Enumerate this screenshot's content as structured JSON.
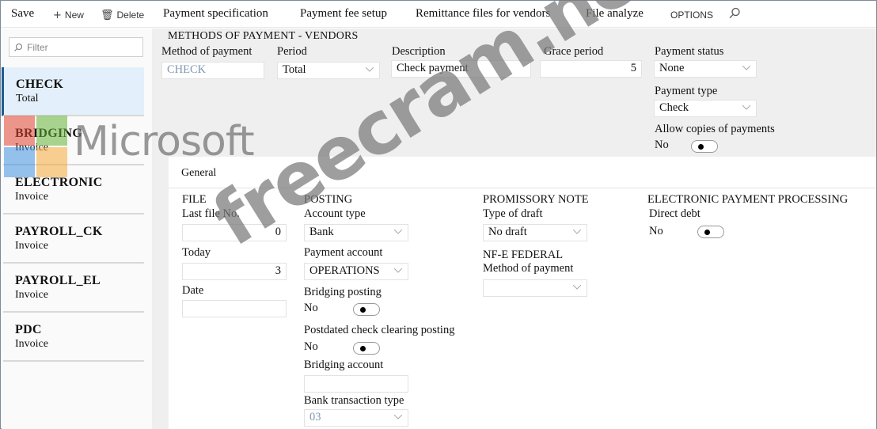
{
  "toolbar": {
    "save": "Save",
    "new": "New",
    "delete": "Delete",
    "payment_specification": "Payment specification",
    "payment_fee_setup": "Payment fee setup",
    "remittance_files": "Remittance files for vendors",
    "file_analyze": "File analyze",
    "options": "OPTIONS",
    "icons": {
      "new": "plus-icon",
      "delete": "trash-icon",
      "search": "search-icon"
    }
  },
  "sidebar": {
    "filter_placeholder": "Filter",
    "items": [
      {
        "title": "CHECK",
        "subtitle": "Total",
        "selected": true
      },
      {
        "title": "BRIDGING",
        "subtitle": "Invoice",
        "selected": false
      },
      {
        "title": "ELECTRONIC",
        "subtitle": "Invoice",
        "selected": false
      },
      {
        "title": "PAYROLL_CK",
        "subtitle": "Invoice",
        "selected": false
      },
      {
        "title": "PAYROLL_EL",
        "subtitle": "Invoice",
        "selected": false
      },
      {
        "title": "PDC",
        "subtitle": "Invoice",
        "selected": false
      }
    ]
  },
  "header": {
    "section_title": "METHODS OF PAYMENT - VENDORS",
    "method_of_payment": {
      "label": "Method of payment",
      "value": "CHECK"
    },
    "period": {
      "label": "Period",
      "value": "Total"
    },
    "description": {
      "label": "Description",
      "value": "Check payment"
    },
    "grace_period": {
      "label": "Grace period",
      "value": "5"
    },
    "payment_status": {
      "label": "Payment status",
      "value": "None"
    },
    "payment_type": {
      "label": "Payment type",
      "value": "Check"
    },
    "allow_copies": {
      "label": "Allow copies of payments",
      "value": "No"
    }
  },
  "general": {
    "tab_label": "General",
    "file": {
      "title": "FILE",
      "last_file_no": {
        "label": "Last file No.",
        "value": "0"
      },
      "today": {
        "label": "Today",
        "value": "3"
      },
      "date": {
        "label": "Date",
        "value": ""
      }
    },
    "posting": {
      "title": "POSTING",
      "account_type": {
        "label": "Account type",
        "value": "Bank"
      },
      "payment_account": {
        "label": "Payment account",
        "value": "OPERATIONS"
      },
      "bridging_posting": {
        "label": "Bridging posting",
        "value": "No"
      },
      "postdated_check": {
        "label": "Postdated check clearing posting",
        "value": "No"
      },
      "bridging_account": {
        "label": "Bridging account",
        "value": ""
      },
      "bank_transaction_type": {
        "label": "Bank transaction type",
        "value": "03"
      }
    },
    "promissory_note": {
      "title": "PROMISSORY NOTE",
      "type_of_draft": {
        "label": "Type of draft",
        "value": "No draft"
      }
    },
    "nfe_federal": {
      "title": "NF-E FEDERAL",
      "method_of_payment": {
        "label": "Method of payment",
        "value": ""
      }
    },
    "electronic_processing": {
      "title": "ELECTRONIC PAYMENT PROCESSING",
      "direct_debt": {
        "label": "Direct debt",
        "value": "No"
      }
    }
  },
  "watermarks": {
    "logo_text": "Microsoft",
    "site_text": "freecram.net"
  },
  "colors": {
    "selected_bg": "#e3f0fb",
    "selected_bar": "#1e5a91",
    "header_bg": "#efefef",
    "muted_value": "#7f97b0"
  }
}
